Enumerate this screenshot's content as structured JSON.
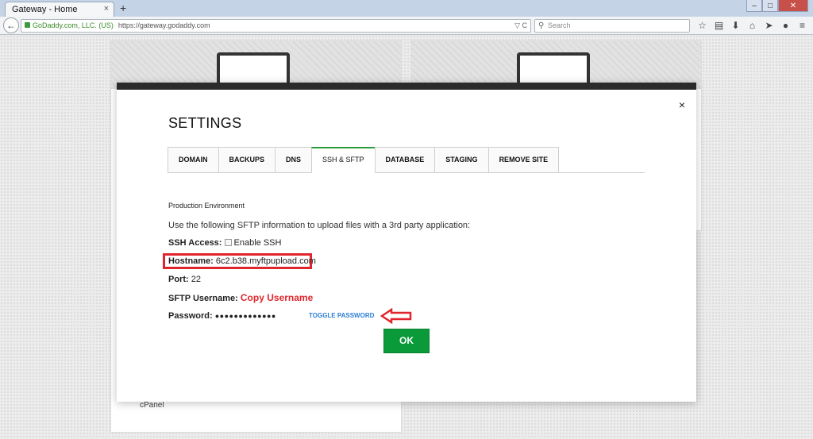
{
  "browser": {
    "tab_title": "Gateway - Home",
    "tab_close": "×",
    "new_tab": "+",
    "identity": "GoDaddy.com, LLC. (US)",
    "url": "https://gateway.godaddy.com",
    "search_placeholder": "Search",
    "window_buttons": [
      "–",
      "□",
      "✕"
    ]
  },
  "page": {
    "cpanel_label": "cPanel"
  },
  "modal": {
    "close_label": "×",
    "title": "SETTINGS",
    "tabs": [
      {
        "label": "DOMAIN"
      },
      {
        "label": "BACKUPS"
      },
      {
        "label": "DNS"
      },
      {
        "label": "SSH & SFTP"
      },
      {
        "label": "DATABASE"
      },
      {
        "label": "STAGING"
      },
      {
        "label": "REMOVE SITE"
      }
    ],
    "active_tab": "SSH & SFTP",
    "environment_label": "Production Environment",
    "intro": "Use the following SFTP information to upload files with a 3rd party application:",
    "ssh_access_label": "SSH Access:",
    "enable_ssh_label": "Enable SSH",
    "enable_ssh_checked": false,
    "hostname_label": "Hostname:",
    "hostname_value": "6c2.b38.myftpupload.com",
    "port_label": "Port:",
    "port_value": "22",
    "sftp_username_label": "SFTP Username:",
    "sftp_username_value": "Copy Username",
    "password_label": "Password:",
    "password_value": "●●●●●●●●●●●●●",
    "toggle_password_label": "TOGGLE PASSWORD",
    "ok_label": "OK"
  },
  "colors": {
    "accent_green": "#0b9a3a",
    "highlight_red": "#e0262c",
    "link_blue": "#2a7fd4"
  }
}
